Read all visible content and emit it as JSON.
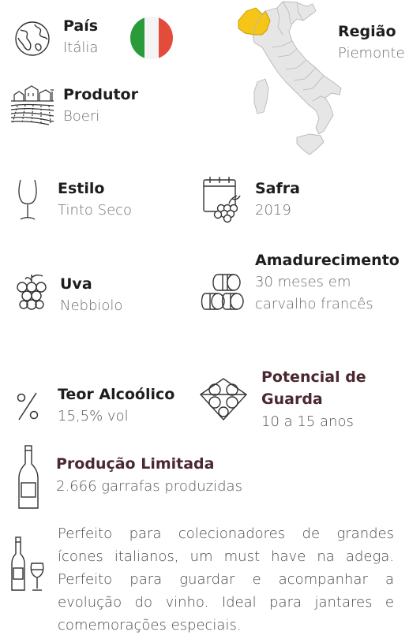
{
  "country": {
    "label": "País",
    "value": "Itália"
  },
  "region": {
    "label": "Região",
    "value": "Piemonte"
  },
  "producer": {
    "label": "Produtor",
    "value": "Boeri"
  },
  "style": {
    "label": "Estilo",
    "value": "Tinto Seco"
  },
  "vintage": {
    "label": "Safra",
    "value": "2019"
  },
  "aging": {
    "label": "Amadurecimento",
    "value_line1": "30 meses em",
    "value_line2": "carvalho francês"
  },
  "grape": {
    "label": "Uva",
    "value": "Nebbiolo"
  },
  "alcohol": {
    "label": "Teor Alcoólico",
    "value": "15,5% vol"
  },
  "cellar": {
    "label_line1": "Potencial de",
    "label_line2": "Guarda",
    "value": "10 a 15 anos"
  },
  "production": {
    "label": "Produção Limitada",
    "value": "2.666 garrafas produzidas"
  },
  "description": "Perfeito para colecionadores de grandes ícones italianos, um must have na adega. Perfeito para guardar e acompanhar a evolução do vinho. Ideal para jantares e comemorações especiais.",
  "colors": {
    "flag_green": "#2a9b3a",
    "flag_red": "#e34b3b",
    "map_gray": "#e6e6e6",
    "map_highlight": "#f5c518",
    "accent": "#4a2830"
  },
  "icons": {
    "country": "globe-icon",
    "flag": "italy-flag-icon",
    "region": "italy-map-icon",
    "producer": "vineyard-icon",
    "style": "wine-glass-icon",
    "vintage": "calendar-grapes-icon",
    "grape": "grapes-icon",
    "aging": "barrels-icon",
    "alcohol": "percent-icon",
    "cellar": "bottle-rack-icon",
    "production": "bottle-icon",
    "description": "bottle-and-glass-icon"
  }
}
